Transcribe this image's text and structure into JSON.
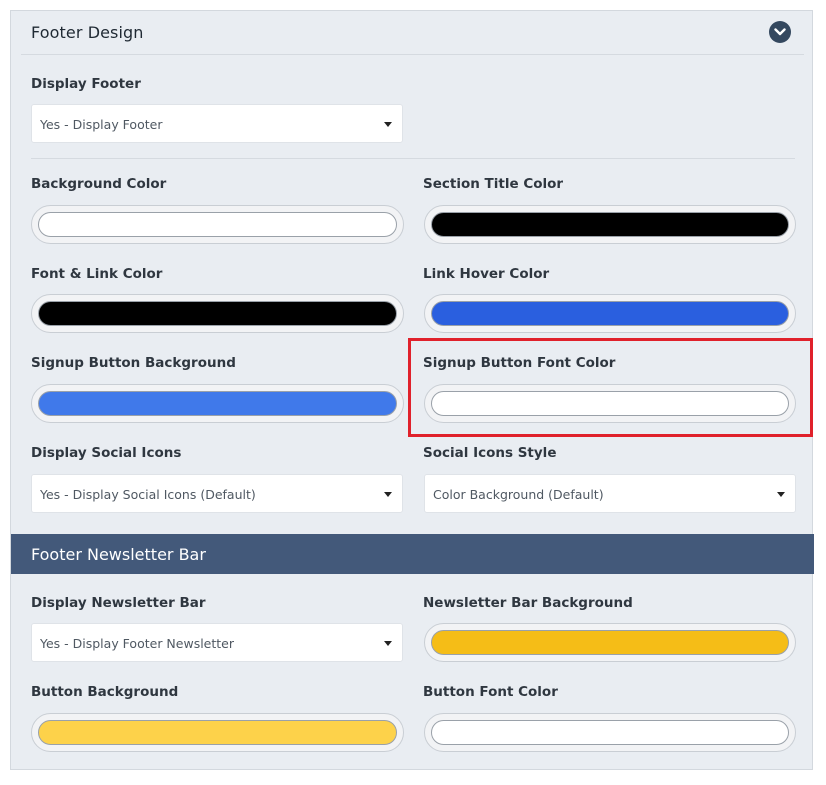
{
  "footer_design": {
    "title": "Footer Design",
    "display_footer": {
      "label": "Display Footer",
      "value": "Yes - Display Footer"
    },
    "background_color": {
      "label": "Background Color",
      "color": "#ffffff"
    },
    "section_title_color": {
      "label": "Section Title Color",
      "color": "#000000"
    },
    "font_link_color": {
      "label": "Font & Link Color",
      "color": "#000000"
    },
    "link_hover_color": {
      "label": "Link Hover Color",
      "color": "#2a5fdf"
    },
    "signup_button_background": {
      "label": "Signup Button Background",
      "color": "#4079ea"
    },
    "signup_button_font_color": {
      "label": "Signup Button Font Color",
      "color": "#ffffff"
    },
    "display_social_icons": {
      "label": "Display Social Icons",
      "value": "Yes - Display Social Icons (Default)"
    },
    "social_icons_style": {
      "label": "Social Icons Style",
      "value": "Color Background (Default)"
    }
  },
  "newsletter_bar": {
    "title": "Footer Newsletter Bar",
    "display_newsletter_bar": {
      "label": "Display Newsletter Bar",
      "value": "Yes - Display Footer Newsletter"
    },
    "newsletter_bar_background": {
      "label": "Newsletter Bar Background",
      "color": "#f5bd17"
    },
    "button_background": {
      "label": "Button Background",
      "color": "#fdd24a"
    },
    "button_font_color": {
      "label": "Button Font Color",
      "color": "#ffffff"
    }
  },
  "colors": {
    "panel_bg": "#e9edf2",
    "bar_bg": "#43597a",
    "highlight_border": "#e0212b"
  }
}
